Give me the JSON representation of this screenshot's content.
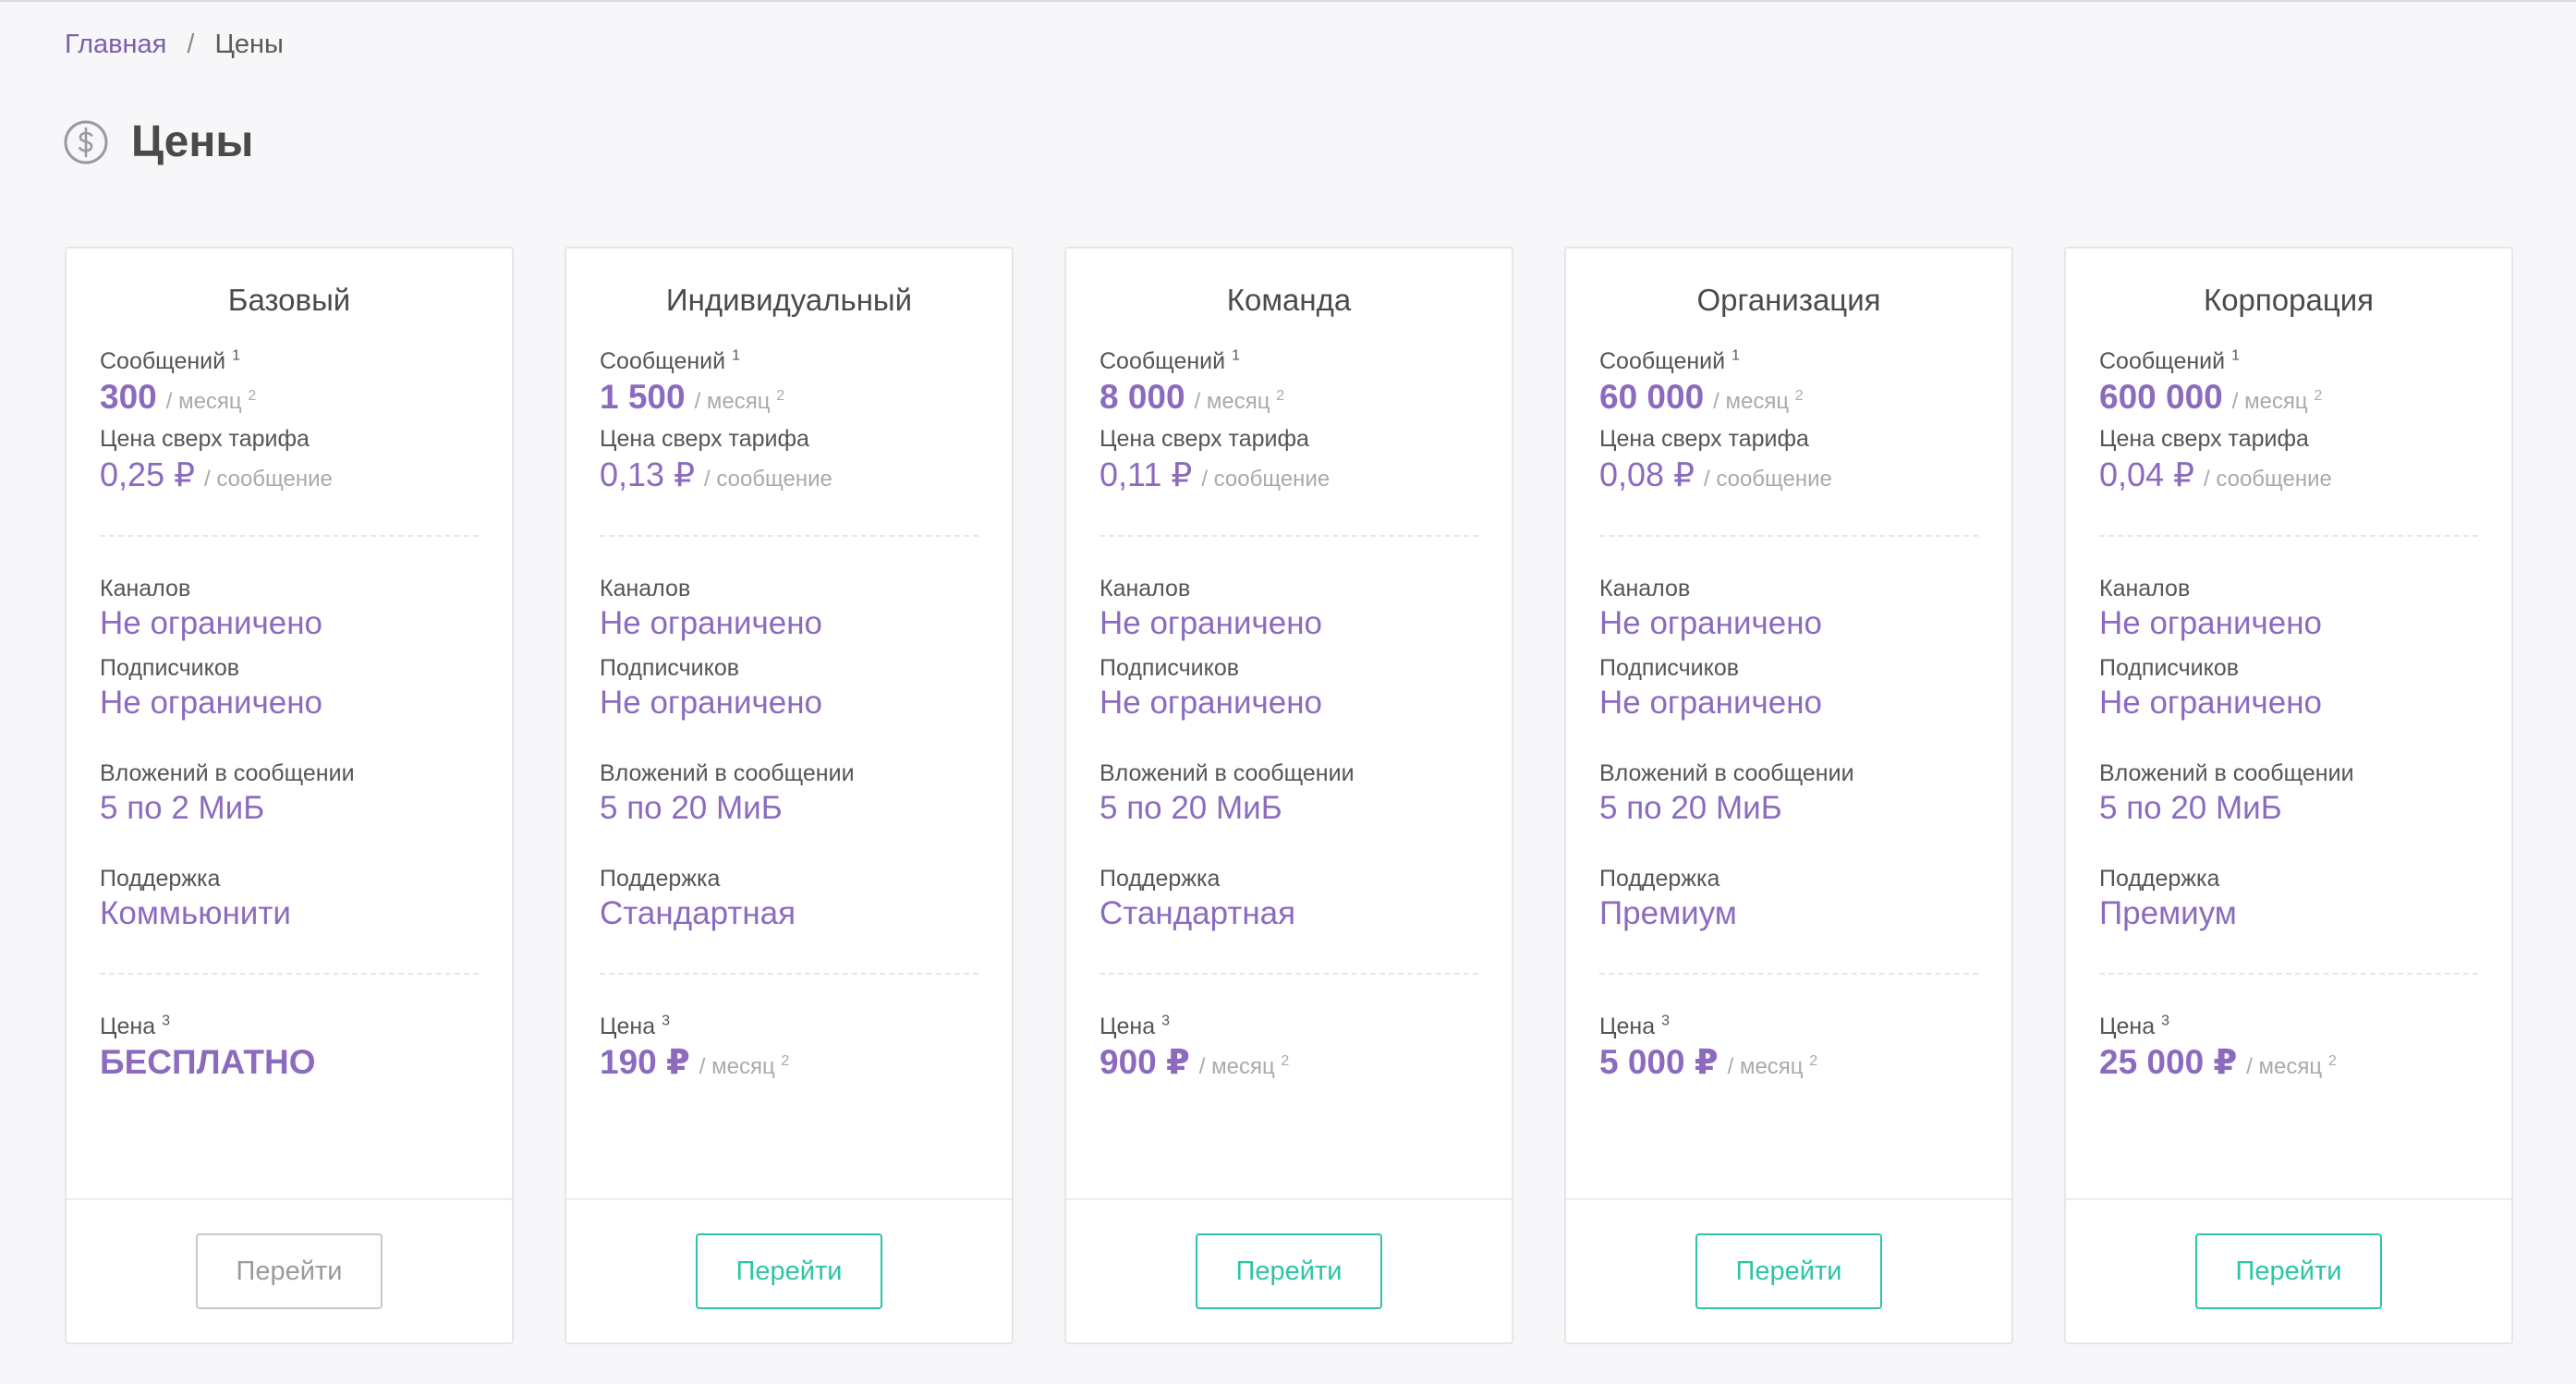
{
  "breadcrumb": {
    "home": "Главная",
    "separator": "/",
    "current": "Цены"
  },
  "page": {
    "title": "Цены",
    "icon": "dollar-circle-icon"
  },
  "colors": {
    "accent": "#8c6bbf",
    "button": "#2ec4a6",
    "breadcrumb_link": "#7a5fb0"
  },
  "labels": {
    "messages": "Сообщений",
    "messages_sup": "1",
    "per_month": "/ месяц",
    "per_month_sup": "2",
    "overage": "Цена сверх тарифа",
    "per_message": "/ сообщение",
    "channels": "Каналов",
    "subscribers": "Подписчиков",
    "attachments": "Вложений в сообщении",
    "support": "Поддержка",
    "price": "Цена",
    "price_sup": "3"
  },
  "plans": [
    {
      "name": "Базовый",
      "messages": "300",
      "overage": "0,25 ₽",
      "channels": "Не ограничено",
      "subscribers": "Не ограничено",
      "attachments": "5 по 2 МиБ",
      "support": "Коммьюнити",
      "price": "БЕСПЛАТНО",
      "button": "Перейти",
      "enabled": false
    },
    {
      "name": "Индивидуальный",
      "messages": "1 500",
      "overage": "0,13 ₽",
      "channels": "Не ограничено",
      "subscribers": "Не ограничено",
      "attachments": "5 по 20 МиБ",
      "support": "Стандартная",
      "price": "190 ₽",
      "button": "Перейти",
      "enabled": true
    },
    {
      "name": "Команда",
      "messages": "8 000",
      "overage": "0,11 ₽",
      "channels": "Не ограничено",
      "subscribers": "Не ограничено",
      "attachments": "5 по 20 МиБ",
      "support": "Стандартная",
      "price": "900 ₽",
      "button": "Перейти",
      "enabled": true
    },
    {
      "name": "Организация",
      "messages": "60 000",
      "overage": "0,08 ₽",
      "channels": "Не ограничено",
      "subscribers": "Не ограничено",
      "attachments": "5 по 20 МиБ",
      "support": "Премиум",
      "price": "5 000 ₽",
      "button": "Перейти",
      "enabled": true
    },
    {
      "name": "Корпорация",
      "messages": "600 000",
      "overage": "0,04 ₽",
      "channels": "Не ограничено",
      "subscribers": "Не ограничено",
      "attachments": "5 по 20 МиБ",
      "support": "Премиум",
      "price": "25 000 ₽",
      "button": "Перейти",
      "enabled": true
    }
  ]
}
